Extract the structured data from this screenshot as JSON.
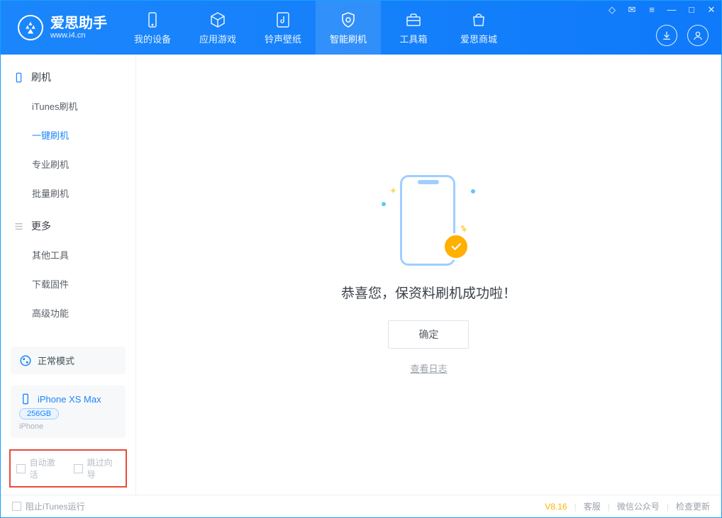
{
  "brand": {
    "name": "爱思助手",
    "site": "www.i4.cn"
  },
  "nav": {
    "items": [
      {
        "label": "我的设备"
      },
      {
        "label": "应用游戏"
      },
      {
        "label": "铃声壁纸"
      },
      {
        "label": "智能刷机"
      },
      {
        "label": "工具箱"
      },
      {
        "label": "爱思商城"
      }
    ]
  },
  "sidebar": {
    "section1": {
      "title": "刷机",
      "items": [
        "iTunes刷机",
        "一键刷机",
        "专业刷机",
        "批量刷机"
      ]
    },
    "section2": {
      "title": "更多",
      "items": [
        "其他工具",
        "下载固件",
        "高级功能"
      ]
    },
    "mode_label": "正常模式",
    "device": {
      "name": "iPhone XS Max",
      "storage": "256GB",
      "type": "iPhone"
    },
    "checks": {
      "auto_activate": "自动激活",
      "skip_guide": "跳过向导"
    }
  },
  "result": {
    "title": "恭喜您，保资料刷机成功啦！",
    "confirm": "确定",
    "view_log": "查看日志"
  },
  "footer": {
    "block_itunes": "阻止iTunes运行",
    "version": "V8.16",
    "links": [
      "客服",
      "微信公众号",
      "检查更新"
    ]
  }
}
